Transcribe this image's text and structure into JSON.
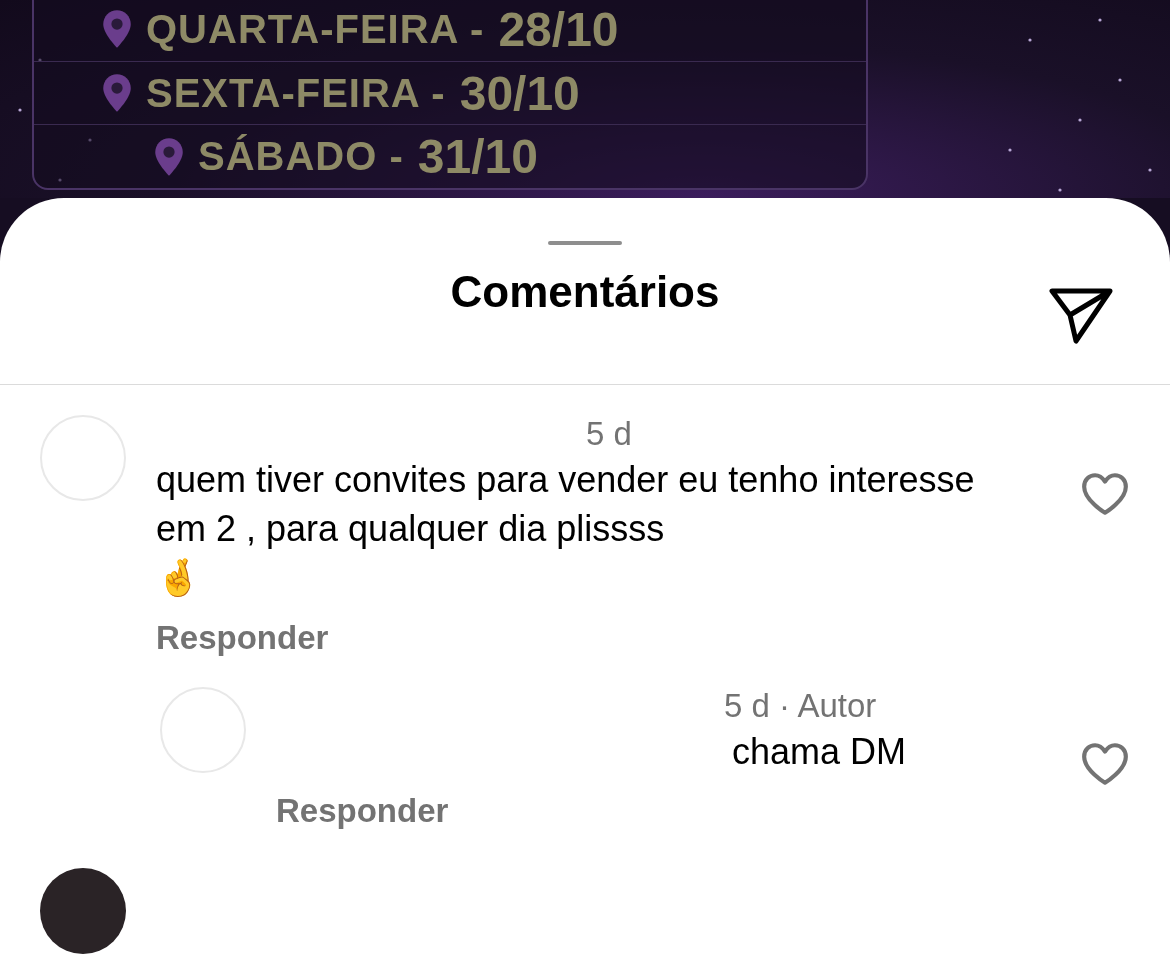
{
  "poster": {
    "dates": [
      {
        "day": "QUARTA-FEIRA",
        "separator": "-",
        "date": "28/10"
      },
      {
        "day": "SEXTA-FEIRA",
        "separator": "-",
        "date": "30/10"
      },
      {
        "day": "SÁBADO",
        "separator": "-",
        "date": "31/10"
      }
    ]
  },
  "sheet": {
    "title": "Comentários"
  },
  "comments": [
    {
      "meta": "5 d",
      "text": "quem tiver convites para vender eu tenho interesse em 2 , para qualquer dia plissss",
      "emoji": "🤞",
      "reply": "Responder",
      "liked": false,
      "replies": [
        {
          "meta": "5 d · Autor",
          "text": "chama DM",
          "reply": "Responder",
          "liked": false
        }
      ]
    }
  ]
}
